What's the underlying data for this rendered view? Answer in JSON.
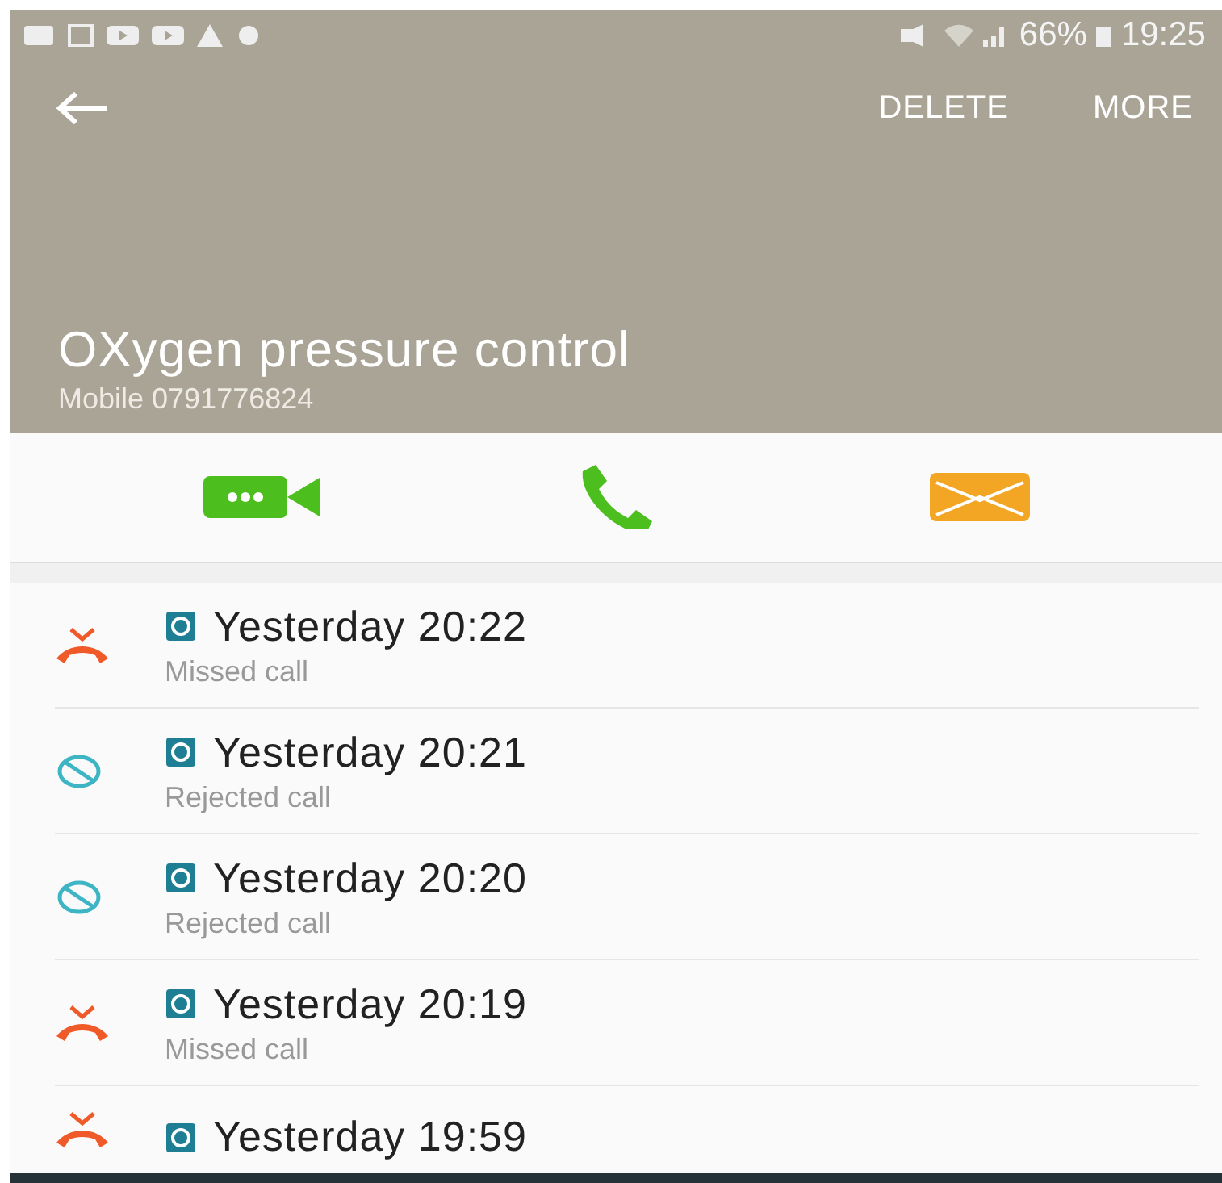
{
  "status_bar": {
    "battery": "66%",
    "time": "19:25"
  },
  "toolbar": {
    "actions": [
      "DELETE",
      "MORE"
    ]
  },
  "contact": {
    "name": "OXygen pressure control",
    "number": "Mobile 0791776824"
  },
  "calls": [
    {
      "kind": "missed",
      "time": "Yesterday 20:22",
      "label": "Missed call"
    },
    {
      "kind": "rejected",
      "time": "Yesterday 20:21",
      "label": "Rejected call"
    },
    {
      "kind": "rejected",
      "time": "Yesterday 20:20",
      "label": "Rejected call"
    },
    {
      "kind": "missed",
      "time": "Yesterday 20:19",
      "label": "Missed call"
    },
    {
      "kind": "missed",
      "time": "Yesterday 19:59"
    }
  ]
}
